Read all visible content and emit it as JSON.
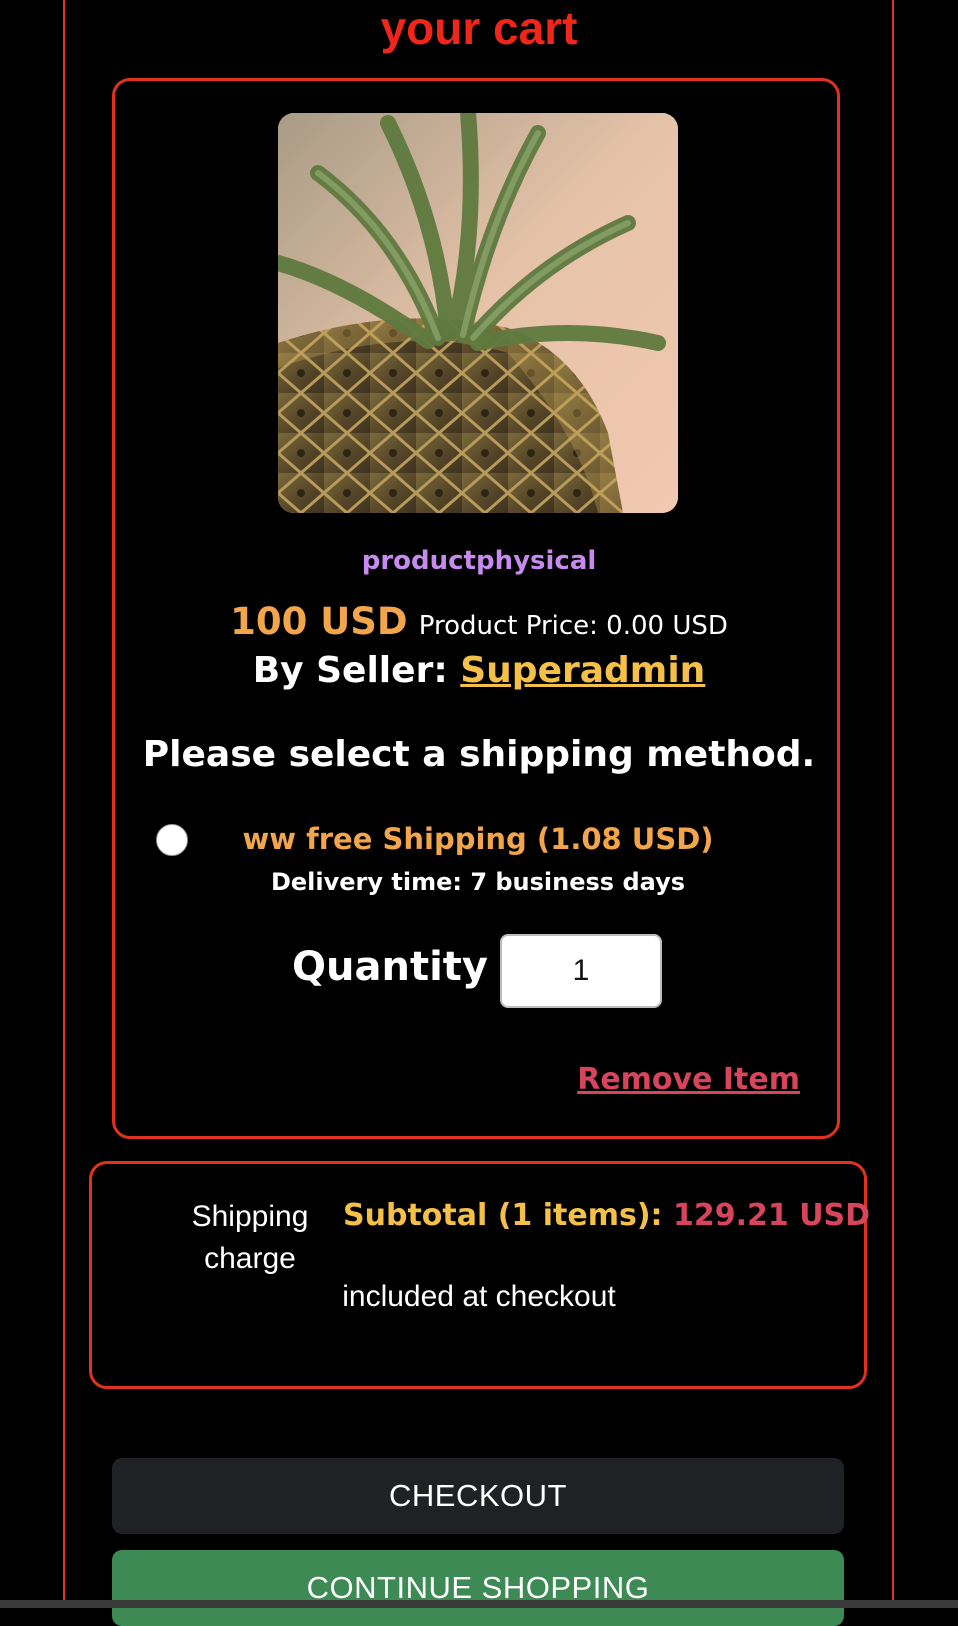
{
  "page": {
    "title": "your cart"
  },
  "item": {
    "image_icon": "pineapple-photo",
    "name": "productphysical",
    "price": "100 USD",
    "product_price": "Product Price: 0.00 USD",
    "seller_prefix": "By Seller: ",
    "seller_name": "Superadmin",
    "shipping_heading": "Please select a shipping method.",
    "shipping_option": {
      "name": "ww free Shipping (1.08 USD)",
      "delivery": "Delivery time: 7 business days",
      "selected": false
    },
    "quantity_label": "Quantity :",
    "quantity_value": "1",
    "remove_label": "Remove Item"
  },
  "summary": {
    "shipping_charge": "Shipping charge",
    "subtotal_label": "Subtotal (1 items):",
    "subtotal_value": "129.21 USD",
    "included_note": "included at checkout"
  },
  "actions": {
    "checkout_label": "CHECKOUT",
    "continue_label": "CONTINUE SHOPPING"
  },
  "colors": {
    "accent_red": "#e0321e",
    "title_red": "#f0261a",
    "price_orange": "#f2a54a",
    "seller_yellow": "#f5c047",
    "product_purple": "#c78bf0",
    "remove_red": "#d6455b",
    "checkout_bg": "#1f2124",
    "continue_bg": "#3e8a55"
  }
}
